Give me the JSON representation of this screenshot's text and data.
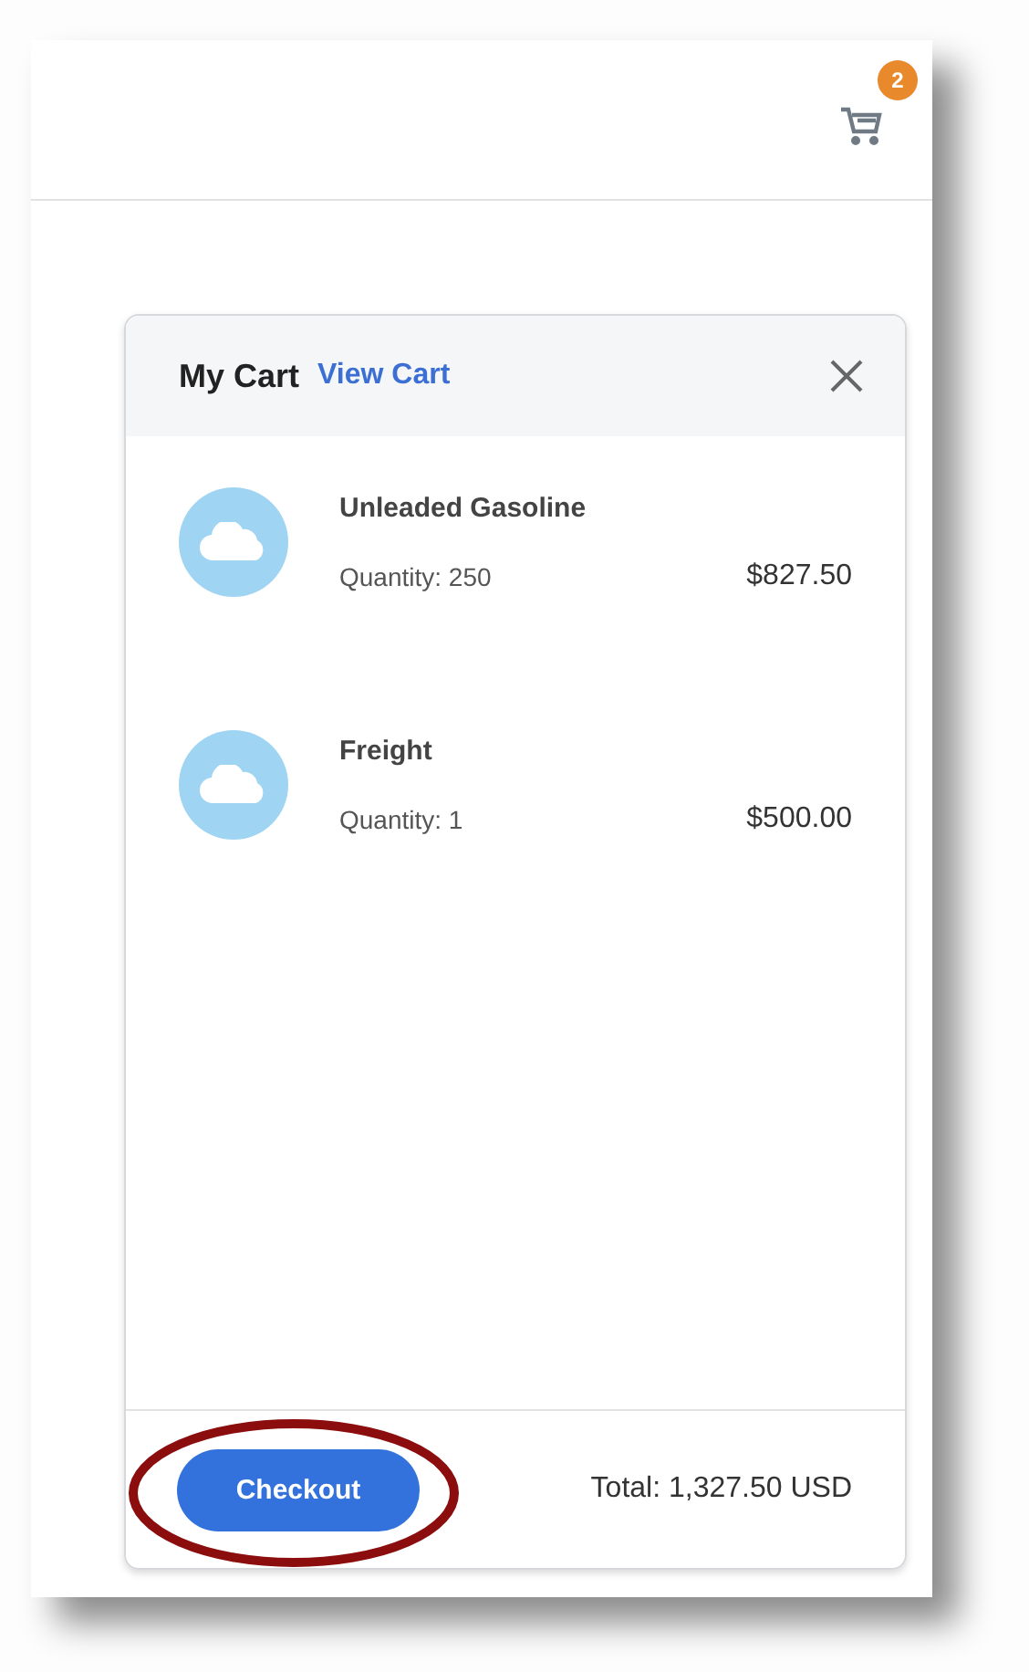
{
  "header": {
    "cart_badge": "2"
  },
  "cart": {
    "title": "My Cart",
    "view_link": "View Cart",
    "items": [
      {
        "name": "Unleaded Gasoline",
        "quantity": "Quantity: 250",
        "price": "$827.50"
      },
      {
        "name": "Freight",
        "quantity": "Quantity: 1",
        "price": "$500.00"
      }
    ],
    "checkout": "Checkout",
    "total": "Total: 1,327.50 USD"
  }
}
